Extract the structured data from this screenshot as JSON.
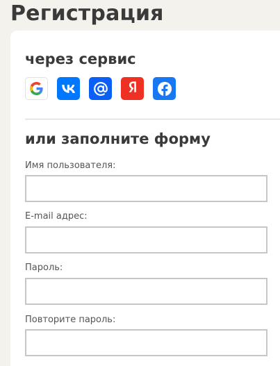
{
  "page": {
    "title": "Регистрация"
  },
  "social": {
    "title": "через сервис",
    "providers": [
      {
        "name": "Google",
        "icon": "google-icon",
        "color": "#ffffff"
      },
      {
        "name": "VK",
        "icon": "vk-icon",
        "color": "#0077ff"
      },
      {
        "name": "Mail.ru",
        "icon": "at-sign-icon",
        "color": "#0a5ff5"
      },
      {
        "name": "Yandex",
        "icon": "yandex-icon",
        "color": "#ef3124"
      },
      {
        "name": "Facebook",
        "icon": "facebook-icon",
        "color": "#1877f2"
      }
    ]
  },
  "form": {
    "title": "или заполните форму",
    "fields": [
      {
        "label": "Имя пользователя:",
        "value": "",
        "placeholder": ""
      },
      {
        "label": "E-mail адрес:",
        "value": "",
        "placeholder": ""
      },
      {
        "label": "Пароль:",
        "value": "",
        "placeholder": ""
      },
      {
        "label": "Повторите пароль:",
        "value": "",
        "placeholder": ""
      }
    ]
  }
}
